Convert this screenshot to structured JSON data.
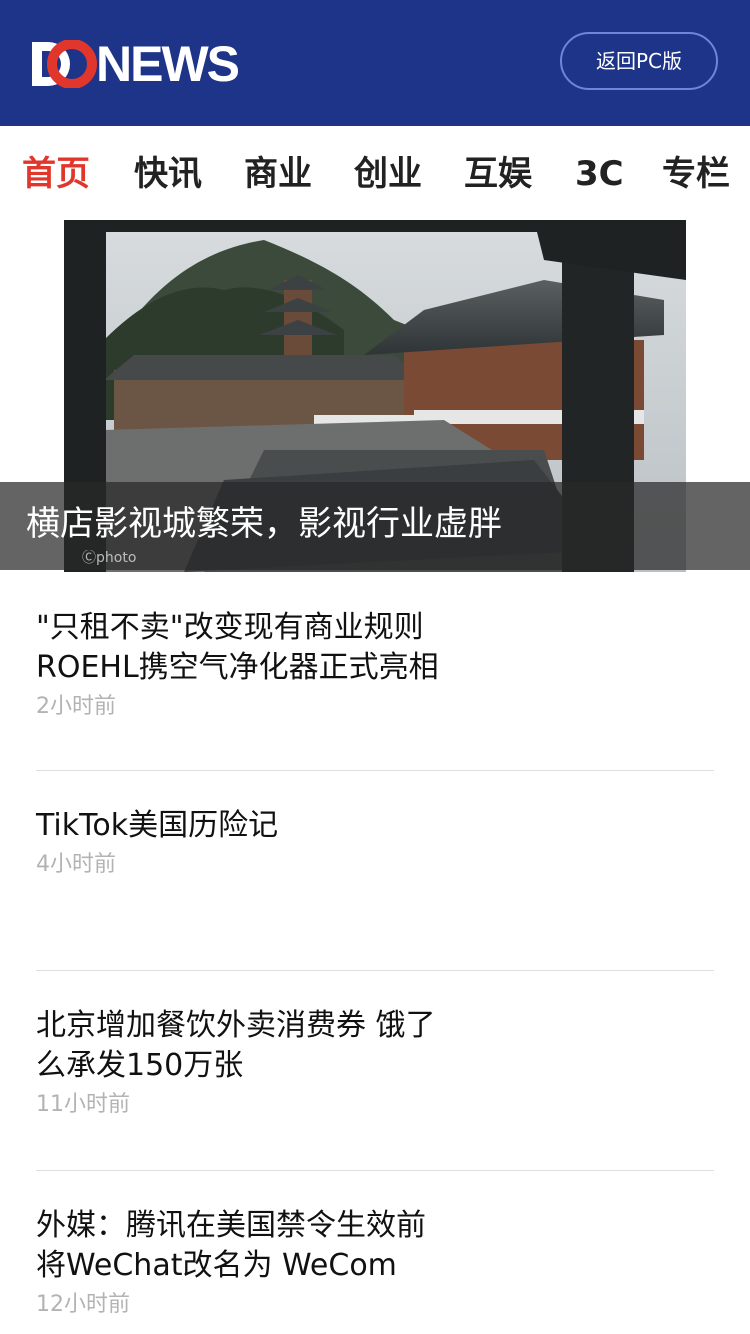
{
  "header": {
    "logo_text": "NEWS",
    "logo_colors": {
      "d": "#ffffff",
      "o": "#e0362c",
      "bg": "#1e3488"
    },
    "pc_button_label": "返回PC版"
  },
  "nav": {
    "items": [
      {
        "label": "首页",
        "active": true
      },
      {
        "label": "快讯"
      },
      {
        "label": "商业"
      },
      {
        "label": "创业"
      },
      {
        "label": "互娱"
      },
      {
        "label": "3C"
      },
      {
        "label": "专栏"
      }
    ],
    "active_color": "#e0362c"
  },
  "hero": {
    "title": "横店影视城繁荣，影视行业虚胖",
    "watermark": "photo"
  },
  "news": [
    {
      "title_lines": [
        "\"只租不卖\"改变现有商业规则",
        "ROEHL携空气净化器正式亮相"
      ],
      "time": "2小时前"
    },
    {
      "title_lines": [
        "TikTok美国历险记"
      ],
      "time": "4小时前"
    },
    {
      "title_lines": [
        "北京增加餐饮外卖消费券 饿了",
        "么承发150万张"
      ],
      "time": "11小时前"
    },
    {
      "title_lines": [
        "外媒：腾讯在美国禁令生效前",
        "将WeChat改名为 WeCom"
      ],
      "time": "12小时前"
    }
  ]
}
